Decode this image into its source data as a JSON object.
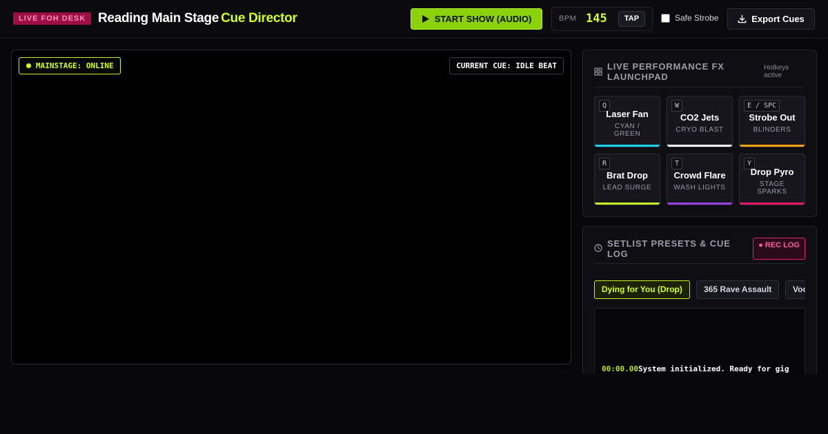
{
  "header": {
    "badge": "LIVE FOH DESK",
    "title": "Reading Main Stage",
    "title_accent": "Cue Director",
    "start_label": "START SHOW (AUDIO)",
    "bpm_label": "BPM",
    "bpm_value": "145",
    "tap_label": "TAP",
    "safe_strobe_label": "Safe Strobe",
    "safe_strobe_checked": false,
    "export_label": "Export Cues"
  },
  "stage": {
    "status": "MAINSTAGE: ONLINE",
    "current_cue": "CURRENT CUE: IDLE BEAT"
  },
  "launchpad": {
    "title": "LIVE PERFORMANCE FX LAUNCHPAD",
    "note": "Hotkeys active",
    "pads": [
      {
        "key": "Q",
        "name": "Laser Fan",
        "sub": "CYAN / GREEN",
        "color": "#19d3f0"
      },
      {
        "key": "W",
        "name": "CO2 Jets",
        "sub": "CRYO BLAST",
        "color": "#ffffff"
      },
      {
        "key": "E / SPC",
        "name": "Strobe Out",
        "sub": "BLINDERS",
        "color": "#f5a20f"
      },
      {
        "key": "R",
        "name": "Brat Drop",
        "sub": "LEAD SURGE",
        "color": "#c7f523"
      },
      {
        "key": "T",
        "name": "Crowd Flare",
        "sub": "WASH LIGHTS",
        "color": "#9b40e6"
      },
      {
        "key": "Y",
        "name": "Drop Pyro",
        "sub": "STAGE SPARKS",
        "color": "#f0156a"
      }
    ]
  },
  "log": {
    "title": "SETLIST PRESETS & CUE LOG",
    "rec_label": "● REC LOG",
    "presets": [
      "Dying for You (Drop)",
      "365 Rave Assault",
      "Voc"
    ],
    "active_preset": 0,
    "entries": [
      {
        "time": "00:00.00",
        "message": "System initialized. Ready for gig"
      }
    ]
  },
  "colors": {
    "accent": "#d4ff1e",
    "live_badge": "#9c0f45",
    "rec": "#e0256e"
  }
}
